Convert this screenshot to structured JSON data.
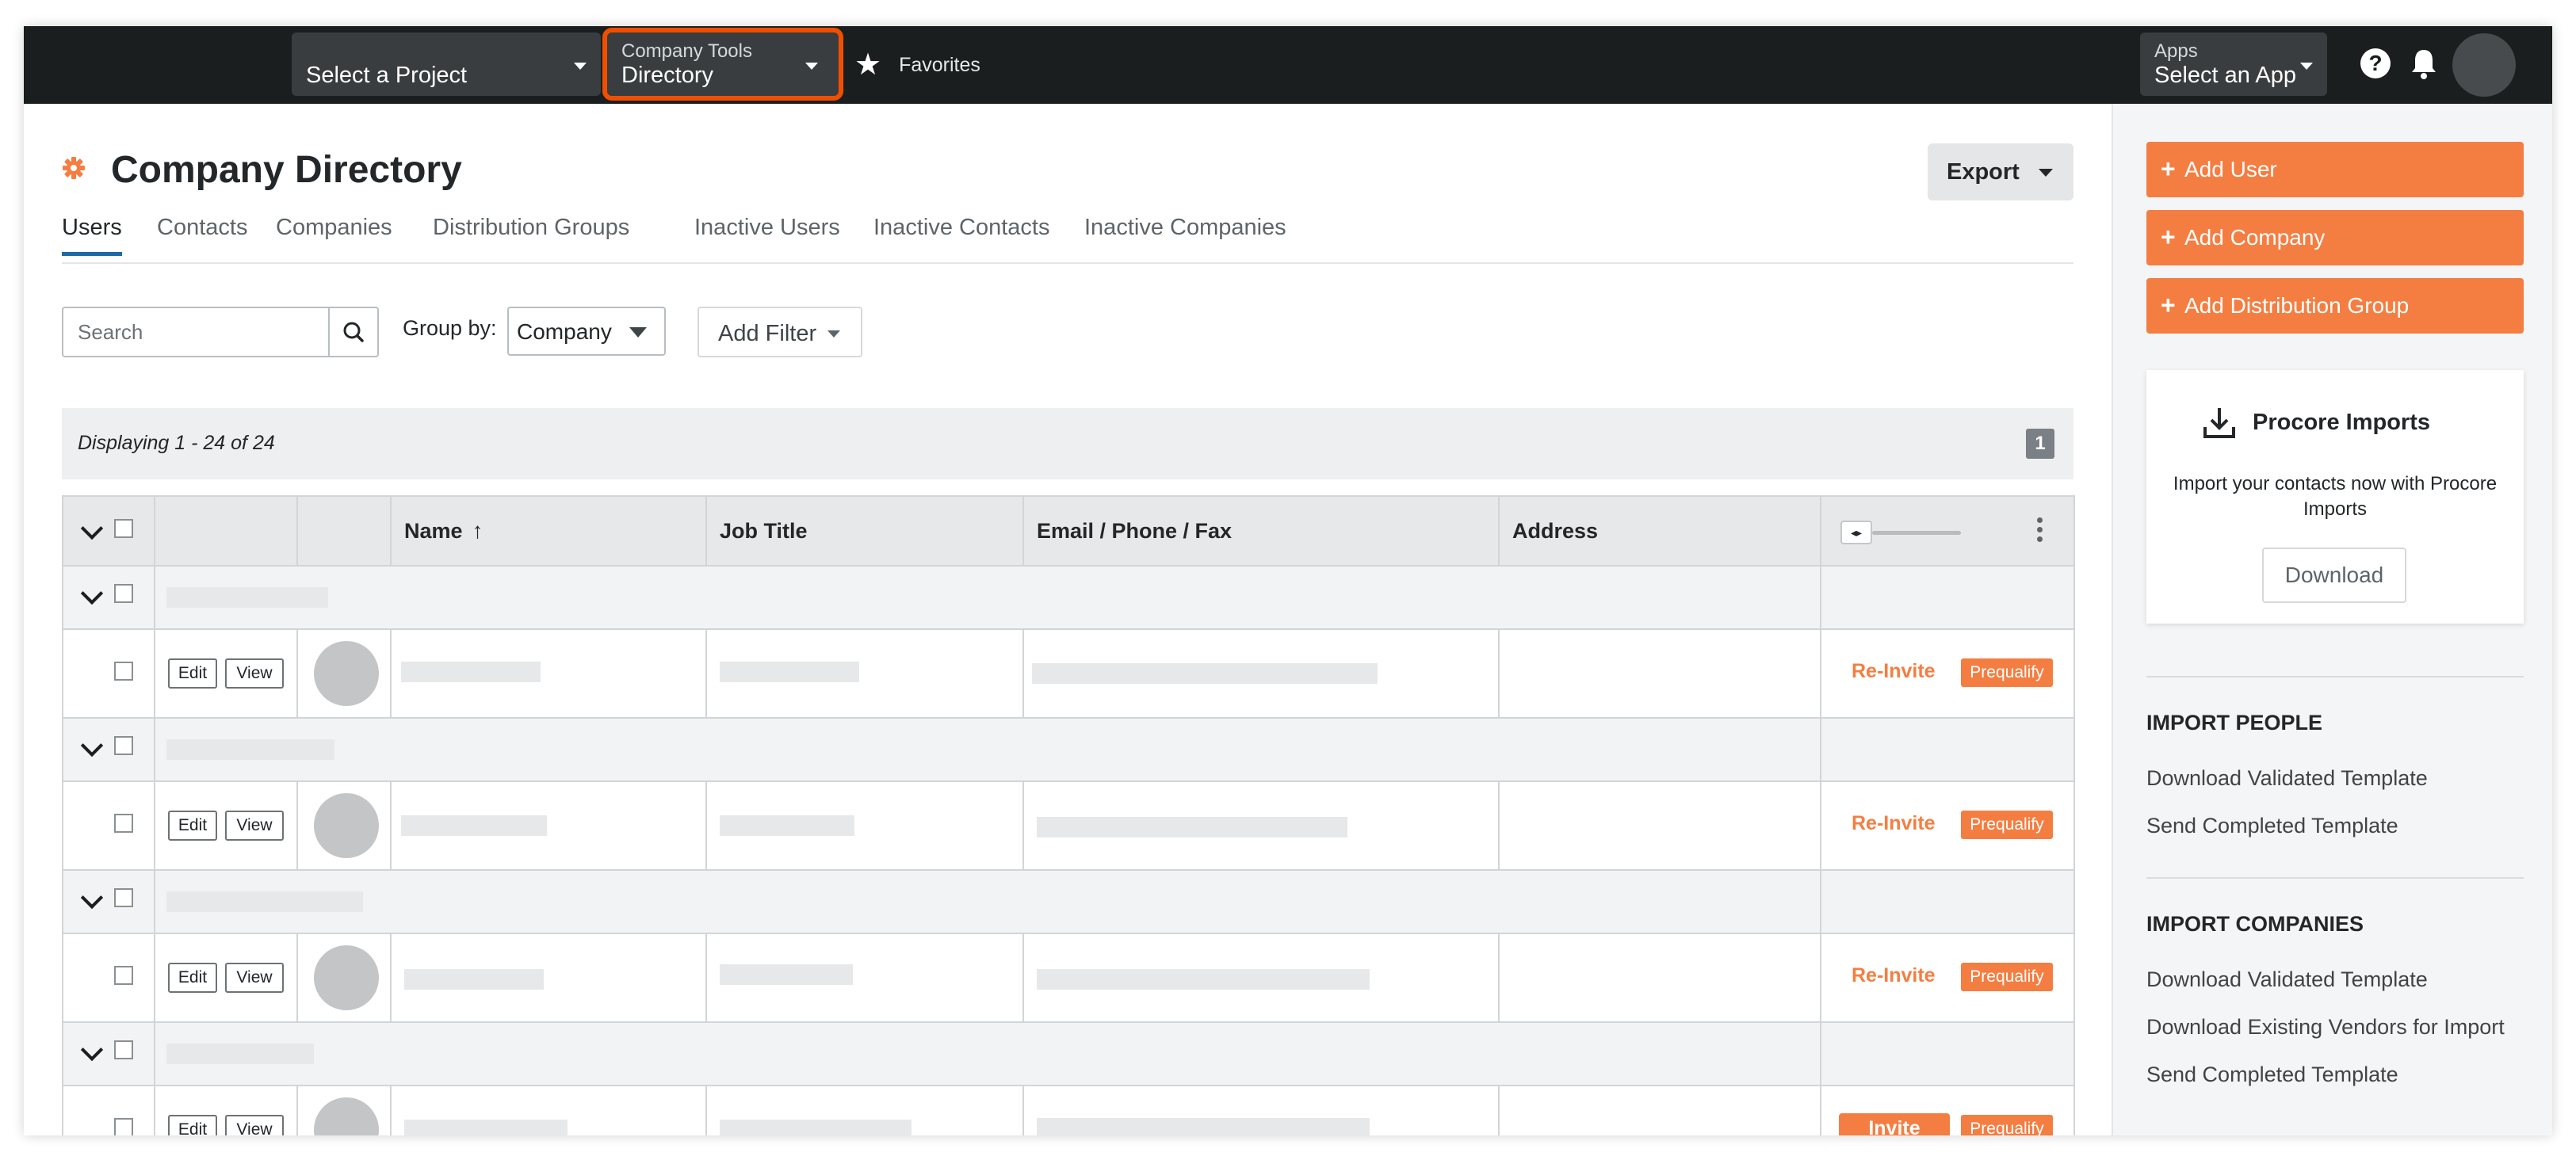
{
  "nav": {
    "project_select": {
      "value": "Select a Project"
    },
    "tools_select": {
      "label": "Company Tools",
      "value": "Directory"
    },
    "favorites_label": "Favorites",
    "apps_select": {
      "label": "Apps",
      "value": "Select an App"
    },
    "help_glyph": "?"
  },
  "page": {
    "title": "Company Directory",
    "export_label": "Export",
    "tabs": [
      "Users",
      "Contacts",
      "Companies",
      "Distribution Groups",
      "Inactive Users",
      "Inactive Contacts",
      "Inactive Companies"
    ],
    "active_tab": "Users"
  },
  "controls": {
    "search_placeholder": "Search",
    "group_by_label": "Group by:",
    "group_by_value": "Company",
    "add_filter_label": "Add Filter"
  },
  "results": {
    "display_text": "Displaying 1 - 24 of 24",
    "page_number": "1"
  },
  "table": {
    "columns": {
      "name": "Name",
      "job_title": "Job Title",
      "email": "Email / Phone / Fax",
      "address": "Address"
    },
    "sort_indicator": "↑",
    "resize_glyph": "◂▸",
    "edit_label": "Edit",
    "view_label": "View",
    "rows": [
      {
        "action": "Re-Invite",
        "action_type": "link",
        "prequalify": "Prequalify"
      },
      {
        "action": "Re-Invite",
        "action_type": "link",
        "prequalify": "Prequalify"
      },
      {
        "action": "Re-Invite",
        "action_type": "link",
        "prequalify": "Prequalify"
      },
      {
        "action": "Invite",
        "action_type": "button",
        "prequalify": "Prequalify"
      }
    ]
  },
  "sidebar": {
    "buttons": [
      "Add User",
      "Add Company",
      "Add Distribution Group"
    ],
    "imports_card": {
      "title": "Procore Imports",
      "description": "Import your contacts now with Procore Imports",
      "download_label": "Download"
    },
    "import_people": {
      "heading": "IMPORT PEOPLE",
      "links": [
        "Download Validated Template",
        "Send Completed Template"
      ]
    },
    "import_companies": {
      "heading": "IMPORT COMPANIES",
      "links": [
        "Download Validated Template",
        "Download Existing Vendors for Import",
        "Send Completed Template"
      ]
    }
  },
  "colors": {
    "topbar": "#1b1e1f",
    "accent_orange": "#f47e42",
    "highlight_outline": "#f04f00",
    "active_tab_underline": "#1b6aa8"
  }
}
